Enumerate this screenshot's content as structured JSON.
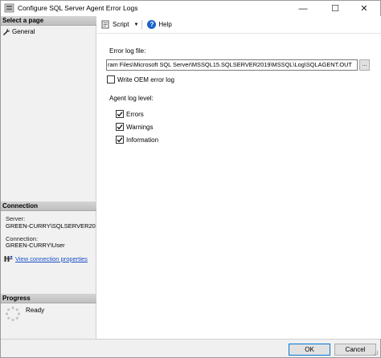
{
  "window": {
    "title": "Configure SQL Server Agent Error Logs",
    "controls": {
      "minimize": "—",
      "maximize": "☐",
      "close": "✕"
    }
  },
  "left_panel": {
    "select_page_header": "Select a page",
    "pages": [
      {
        "label": "General",
        "icon": "wrench-icon"
      }
    ],
    "connection_header": "Connection",
    "server_label": "Server:",
    "server_value": "GREEN-CURRY\\SQLSERVER20",
    "connection_label": "Connection:",
    "connection_value": "GREEN-CURRY\\User",
    "view_connection_link": "View connection properties",
    "progress_header": "Progress",
    "progress_status": "Ready"
  },
  "toolbar": {
    "script_label": "Script",
    "help_label": "Help"
  },
  "form": {
    "error_log_file_label": "Error log file:",
    "error_log_file_value": "ram Files\\Microsoft SQL Server\\MSSQL15.SQLSERVER2019\\MSSQL\\Log\\SQLAGENT.OUT",
    "browse_label": "...",
    "write_oem_label": "Write OEM error log",
    "write_oem_checked": false,
    "agent_log_level_label": "Agent log level:",
    "levels": [
      {
        "label": "Errors",
        "checked": true
      },
      {
        "label": "Warnings",
        "checked": true
      },
      {
        "label": "Information",
        "checked": true
      }
    ]
  },
  "buttons": {
    "ok": "OK",
    "cancel": "Cancel"
  },
  "colors": {
    "link": "#1a4fc9",
    "help_icon": "#1a64c8",
    "ok_border": "#0078d7"
  }
}
